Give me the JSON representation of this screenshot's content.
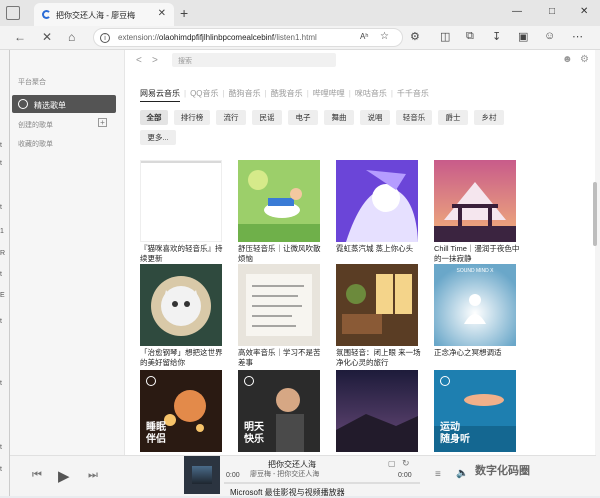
{
  "browser": {
    "tab_title": "把你交还人海 - 廖豆梅",
    "url_prefix": "extension://",
    "url_host": "olaohimdpfifjlhlinbpcomealcebinf",
    "url_path": "/listen1.html",
    "read_aloud": "Aʰ",
    "window_min": "—",
    "window_max": "□",
    "window_close": "✕",
    "tab_close": "✕",
    "new_tab": "+"
  },
  "sidebar": {
    "section_platform": "平台聚合",
    "active_item": "精选歌单",
    "section_created": "创建的歌单",
    "section_collected": "收藏的歌单",
    "add": "+"
  },
  "topbar": {
    "back": "<",
    "forward": ">",
    "search_placeholder": "搜索"
  },
  "sources": [
    "网易云音乐",
    "QQ音乐",
    "酷狗音乐",
    "酷我音乐",
    "哔哩哔哩",
    "咪咕音乐",
    "千千音乐"
  ],
  "active_source": 0,
  "categories": [
    "全部",
    "排行榜",
    "流行",
    "民谣",
    "电子",
    "舞曲",
    "说唱",
    "轻音乐",
    "爵士",
    "乡村",
    "更多..."
  ],
  "playlists": [
    {
      "caption": "『猫咪喜欢的轻音乐』持续更新",
      "overlay": ""
    },
    {
      "caption": "舒压轻音乐｜让微风吹散烦恼",
      "overlay": ""
    },
    {
      "caption": "霓虹蒸汽城 蒸上你心头",
      "overlay": ""
    },
    {
      "caption": "Chill Time｜漫润于夜色中的一抹寂静",
      "overlay": ""
    },
    {
      "caption": "「治愈钢琴」想把这世界的美好留给你",
      "overlay": ""
    },
    {
      "caption": "高效率音乐｜学习不是苦差事",
      "overlay": ""
    },
    {
      "caption": "氛围轻音：闭上眼 来一场净化心灵的旅行",
      "overlay": ""
    },
    {
      "caption": "正念净心之冥想调适",
      "overlay": "SOUND MIND X"
    },
    {
      "caption": "",
      "overlay": "睡眠\n伴侣"
    },
    {
      "caption": "",
      "overlay": "明天\n快乐"
    },
    {
      "caption": "",
      "overlay": ""
    },
    {
      "caption": "",
      "overlay": "运动\n随身听"
    }
  ],
  "player": {
    "title": "把你交还人海",
    "artist": "廖豆梅 - 把你交还人海",
    "current_time": "0:00",
    "total_time": "0:00",
    "watermark": "数字化码圈",
    "below_text": "Microsoft 最佳影视与视频播放器"
  },
  "left_strip": [
    "t",
    "t",
    "t",
    "1",
    "R",
    "t",
    "E",
    "t",
    "t",
    "t",
    "t"
  ],
  "colors": {
    "active_sidebar": "#545454",
    "chrome_bg": "#f3f3f3",
    "player_bg": "#f4f4f4"
  }
}
